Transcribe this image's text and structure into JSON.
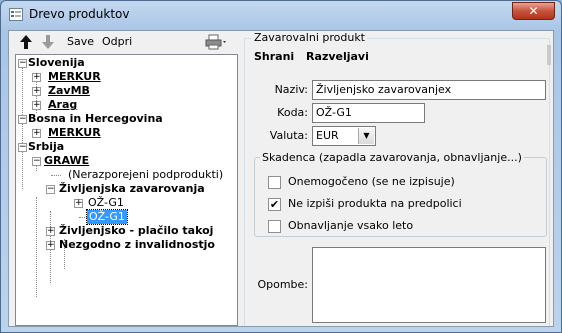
{
  "window": {
    "title": "Drevo produktov",
    "close_glyph": "✕"
  },
  "toolbar": {
    "save_label": "Save",
    "open_label": "Odpri"
  },
  "tree": {
    "slovenia": "Slovenija",
    "merkur1": "MERKUR",
    "zavmb": "ZavMB",
    "arag": "Arag",
    "bih": "Bosna in Hercegovina",
    "merkur2": "MERKUR",
    "srbija": "Srbija",
    "grawe": "GRAWE",
    "unassigned": "(Nerazporejeni podprodukti)",
    "zivljenjska": "Življenjska zavarovanja",
    "oz1": "OŽ-G1",
    "oz2": "OŽ-G1",
    "zivljenjsko_placilo": "Življenjsko - plačilo takoj",
    "nezgodno": "Nezgodno z invalidnostjo"
  },
  "detail": {
    "group_title": "Zavarovalni produkt",
    "save_action": "Shrani",
    "discard_action": "Razveljavi",
    "name_label": "Naziv:",
    "name_value": "Življenjsko zavarovanjex",
    "code_label": "Koda:",
    "code_value": "OŽ-G1",
    "currency_label": "Valuta:",
    "currency_value": "EUR",
    "maturity_title": "Skadenca (zapadla zavarovanja, obnavljanje...)",
    "disabled_label": "Onemogočeno (se ne izpisuje)",
    "disabled_checked": false,
    "no_print_label": "Ne izpiši produkta na predpolici",
    "no_print_checked": true,
    "renew_label": "Obnavljanje vsako leto",
    "renew_checked": false,
    "notes_label": "Opombe:",
    "notes_value": ""
  },
  "colors": {
    "selection": "#3399ff",
    "close_button": "#c7533d"
  },
  "icons": [
    "app-icon",
    "arrow-up-icon",
    "arrow-down-icon",
    "printer-icon",
    "close-icon",
    "dropdown-arrow-icon",
    "checkmark-icon"
  ]
}
